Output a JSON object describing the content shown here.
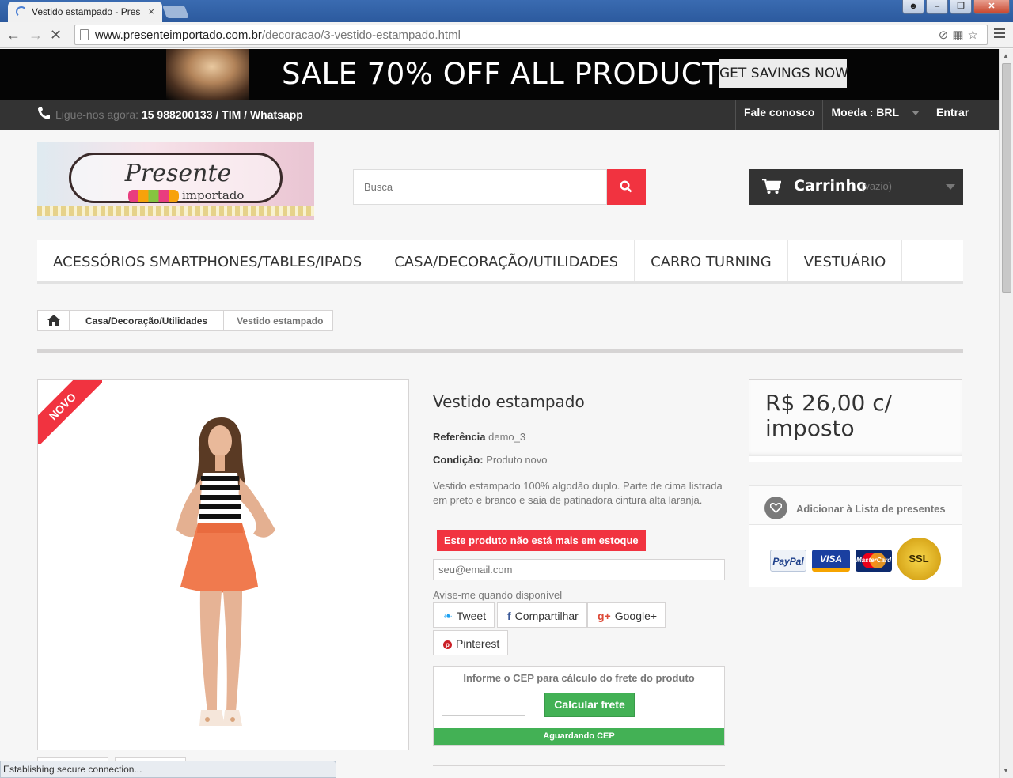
{
  "browser": {
    "tab_title": "Vestido estampado - Pres",
    "tab_close": "×",
    "url_domain": "www.presenteimportado.com.br",
    "url_path": "/decoracao/3-vestido-estampado.html",
    "status": "Establishing secure connection..."
  },
  "promo": {
    "headline": "SALE 70% OFF ALL PRODUCTS",
    "cta": "GET SAVINGS NOW"
  },
  "topnav": {
    "phone_label": "Ligue-nos agora:",
    "phone_number": "15 988200133 / TIM / Whatsapp",
    "links": [
      "Fale conosco",
      "Moeda : BRL",
      "Entrar"
    ]
  },
  "logo": {
    "title": "Presente",
    "subtitle": "importado"
  },
  "search": {
    "placeholder": "Busca"
  },
  "cart": {
    "label": "Carrinho",
    "state": "(vazio)"
  },
  "menu": {
    "items": [
      "ACESSÓRIOS SMARTPHONES/TABLES/IPADS",
      "CASA/DECORAÇÃO/UTILIDADES",
      "CARRO TURNING",
      "VESTUÁRIO"
    ]
  },
  "breadcrumb": {
    "items": [
      "Casa/Decoração/Utilidades",
      "Vestido estampado"
    ]
  },
  "product": {
    "badge": "NOVO",
    "name": "Vestido estampado",
    "reference_label": "Referência",
    "reference_value": "demo_3",
    "condition_label": "Condição:",
    "condition_value": "Produto novo",
    "description": "Vestido estampado 100% algodão duplo. Parte de cima listrada em preto e branco e saia de patinadora cintura alta laranja.",
    "stock_status": "Este produto não está mais em estoque",
    "email_placeholder": "seu@email.com",
    "notify_label": "Avise-me quando disponível",
    "price": "R$ 26,00 c/ imposto",
    "wishlist_label": "Adicionar à Lista de presentes"
  },
  "social": {
    "tweet": "Tweet",
    "share": "Compartilhar",
    "google": "Google+",
    "pinterest": "Pinterest"
  },
  "shipping": {
    "title": "Informe o CEP para cálculo do frete do produto",
    "button": "Calcular frete",
    "status": "Aguardando CEP"
  },
  "payment_logos": {
    "paypal": "PayPal",
    "visa": "VISA",
    "mastercard": "MasterCard",
    "ssl": "SSL"
  },
  "colors": {
    "accent": "#f13340",
    "dark": "#333333",
    "success": "#43b155"
  }
}
